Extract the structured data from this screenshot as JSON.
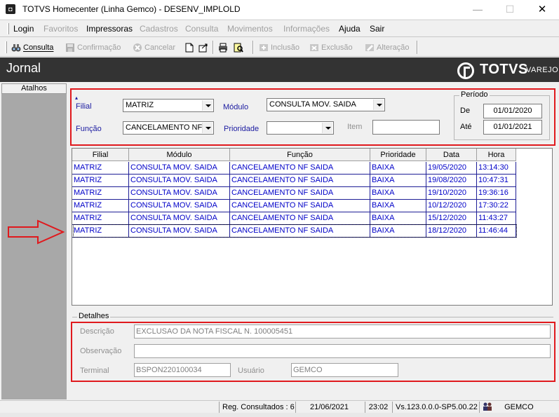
{
  "window": {
    "title": "TOTVS Homecenter (Linha Gemco) - DESENV_IMPLOLD"
  },
  "menu": [
    {
      "label": "Login",
      "enabled": true
    },
    {
      "label": "Favoritos",
      "enabled": false
    },
    {
      "label": "Impressoras",
      "enabled": true
    },
    {
      "label": "Cadastros",
      "enabled": false
    },
    {
      "label": "Consulta",
      "enabled": false
    },
    {
      "label": "Movimentos",
      "enabled": false
    },
    {
      "label": "Informações",
      "enabled": false
    },
    {
      "label": "Ajuda",
      "enabled": true
    },
    {
      "label": "Sair",
      "enabled": true
    }
  ],
  "toolbar": {
    "consulta": "Consulta",
    "confirmacao": "Confirmação",
    "cancelar": "Cancelar",
    "inclusao": "Inclusão",
    "exclusao": "Exclusão",
    "alteracao": "Alteração"
  },
  "header": {
    "title": "Jornal",
    "logo": "TOTVS",
    "logo_sub": "VAREJO"
  },
  "sidebar": {
    "atalhos": "Atalhos"
  },
  "filter": {
    "filial_label": "Filial",
    "filial_value": "MATRIZ",
    "modulo_label": "Módulo",
    "modulo_value": "CONSULTA MOV. SAIDA",
    "funcao_label": "Função",
    "funcao_value": "CANCELAMENTO NF",
    "prioridade_label": "Prioridade",
    "prioridade_value": "",
    "item_label": "Item",
    "item_value": "",
    "periodo_label": "Período",
    "de_label": "De",
    "de_value": "01/01/2020",
    "ate_label": "Até",
    "ate_value": "01/01/2021"
  },
  "grid": {
    "headers": [
      "Filial",
      "Módulo",
      "Função",
      "Prioridade",
      "Data",
      "Hora"
    ],
    "rows": [
      [
        "MATRIZ",
        "CONSULTA MOV. SAIDA",
        "CANCELAMENTO NF SAIDA",
        "BAIXA",
        "19/05/2020",
        "13:14:30"
      ],
      [
        "MATRIZ",
        "CONSULTA MOV. SAIDA",
        "CANCELAMENTO NF SAIDA",
        "BAIXA",
        "19/08/2020",
        "10:47:31"
      ],
      [
        "MATRIZ",
        "CONSULTA MOV. SAIDA",
        "CANCELAMENTO NF SAIDA",
        "BAIXA",
        "19/10/2020",
        "19:36:16"
      ],
      [
        "MATRIZ",
        "CONSULTA MOV. SAIDA",
        "CANCELAMENTO NF SAIDA",
        "BAIXA",
        "10/12/2020",
        "17:30:22"
      ],
      [
        "MATRIZ",
        "CONSULTA MOV. SAIDA",
        "CANCELAMENTO NF SAIDA",
        "BAIXA",
        "15/12/2020",
        "11:43:27"
      ],
      [
        "MATRIZ",
        "CONSULTA MOV. SAIDA",
        "CANCELAMENTO NF SAIDA",
        "BAIXA",
        "18/12/2020",
        "11:46:44"
      ]
    ]
  },
  "details": {
    "legend": "Detalhes",
    "descricao_label": "Descrição",
    "descricao_value": "EXCLUSAO DA NOTA FISCAL N. 100005451",
    "observacao_label": "Observação",
    "observacao_value": "",
    "terminal_label": "Terminal",
    "terminal_value": "BSPON220100034",
    "usuario_label": "Usuário",
    "usuario_value": "GEMCO"
  },
  "status": {
    "registros": "Reg. Consultados : 6",
    "date": "21/06/2021",
    "time": "23:02",
    "version": "Vs.123.0.0.0-SP5.00.22",
    "user": "GEMCO"
  },
  "colors": {
    "highlight_red": "#e0191d",
    "grid_text": "#0000c8",
    "header_dark": "#333333"
  }
}
